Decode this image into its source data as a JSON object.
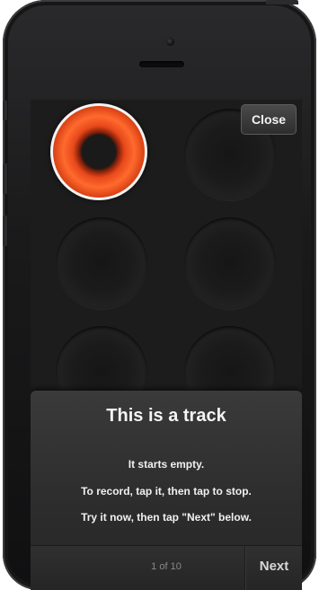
{
  "top_bar": {
    "close_label": "Close"
  },
  "pads": [
    {
      "name": "track-pad-1",
      "state": "active",
      "color": "#e8481a"
    },
    {
      "name": "track-pad-2",
      "state": "empty"
    },
    {
      "name": "track-pad-3",
      "state": "empty"
    },
    {
      "name": "track-pad-4",
      "state": "empty"
    },
    {
      "name": "track-pad-5",
      "state": "empty"
    },
    {
      "name": "track-pad-6",
      "state": "empty"
    }
  ],
  "tutorial": {
    "title": "This is a track",
    "lines": [
      "It starts empty.",
      "To record, tap it, then tap to stop.",
      "Try it now, then tap \"Next\" below."
    ],
    "page_indicator": "1 of 10",
    "next_label": "Next"
  },
  "colors": {
    "accent": "#e8481a",
    "screen_background": "#1c1c1c"
  }
}
